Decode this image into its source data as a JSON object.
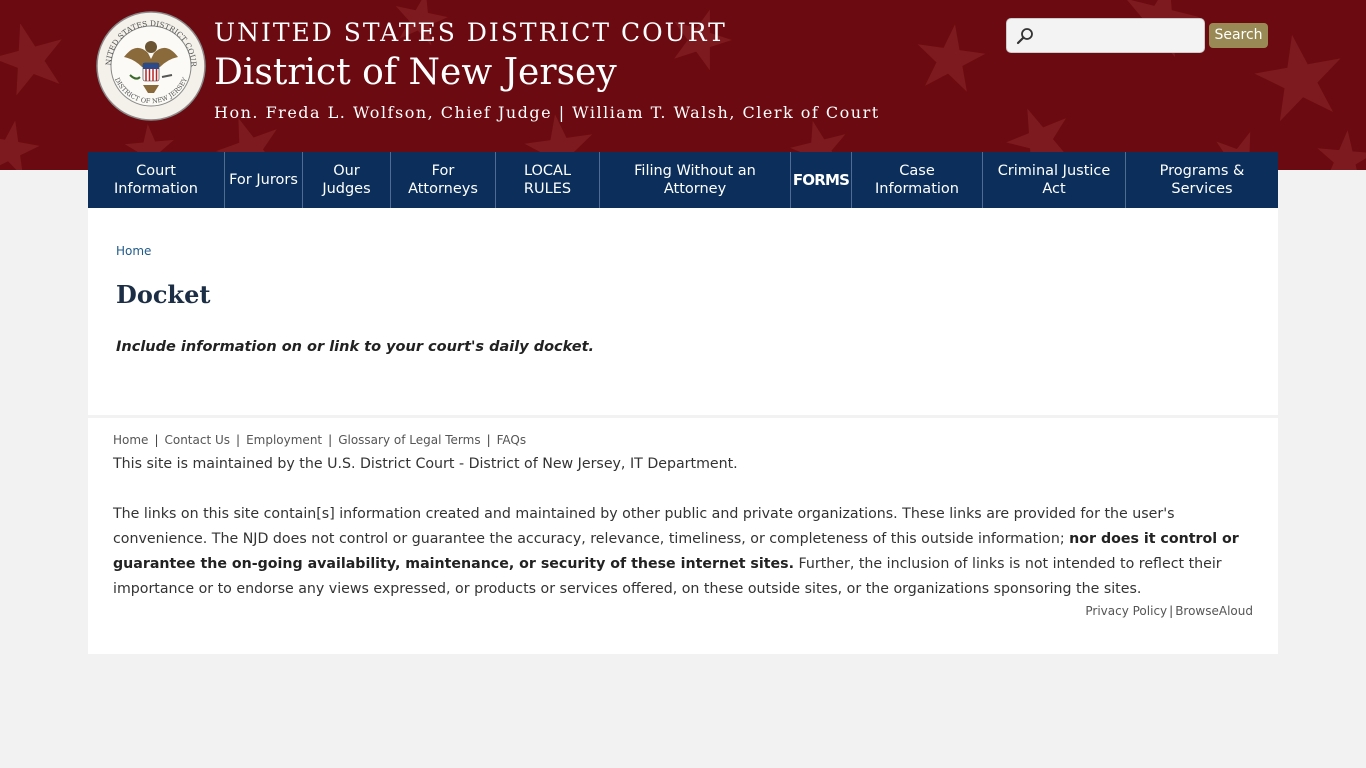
{
  "header": {
    "court_name": "UNITED STATES DISTRICT COURT",
    "district_name": "District of New Jersey",
    "officials": "Hon. Freda L. Wolfson, Chief Judge | William T. Walsh, Clerk of Court",
    "seal_text_top": "UNITED STATES DISTRICT COURT",
    "seal_text_bottom": "DISTRICT OF NEW JERSEY"
  },
  "search": {
    "placeholder": "",
    "value": "",
    "button_label": "Search",
    "icon": "search-icon"
  },
  "nav": {
    "items": [
      {
        "label": "Court Information"
      },
      {
        "label": "For Jurors"
      },
      {
        "label": "Our Judges"
      },
      {
        "label": "For Attorneys"
      },
      {
        "label": "LOCAL RULES"
      },
      {
        "label": "Filing Without an Attorney"
      },
      {
        "label": "FORMS"
      },
      {
        "label": "Case Information"
      },
      {
        "label": "Criminal Justice Act"
      },
      {
        "label": "Programs & Services"
      }
    ]
  },
  "main": {
    "breadcrumb": "Home",
    "title": "Docket",
    "intro": "Include information on or link to your court's daily docket."
  },
  "footer": {
    "links": [
      "Home",
      "Contact Us",
      "Employment",
      "Glossary of Legal Terms",
      "FAQs"
    ],
    "maintained": "This site is maintained by the U.S. District Court - District of New Jersey, IT Department.",
    "disclaimer_part1": "The links on this site contain[s] information created and maintained by other public and private organizations. These links are provided for the user's convenience. The NJD does not control or guarantee the accuracy, relevance, timeliness, or completeness of this outside information; ",
    "disclaimer_bold": "nor does it control or guarantee the on-going availability, maintenance, or security of these internet sites.",
    "disclaimer_part2": " Further, the inclusion of links is not intended to reflect their importance or to endorse any views expressed, or products or services offered, on these outside sites, or the organizations sponsoring the sites.",
    "privacy_label": "Privacy Policy",
    "browsealoud_label": "BrowseAloud"
  },
  "colors": {
    "banner": "#6b0a10",
    "nav": "#0b2f5a",
    "search_button": "#998a55",
    "link": "#1f5a8a"
  }
}
